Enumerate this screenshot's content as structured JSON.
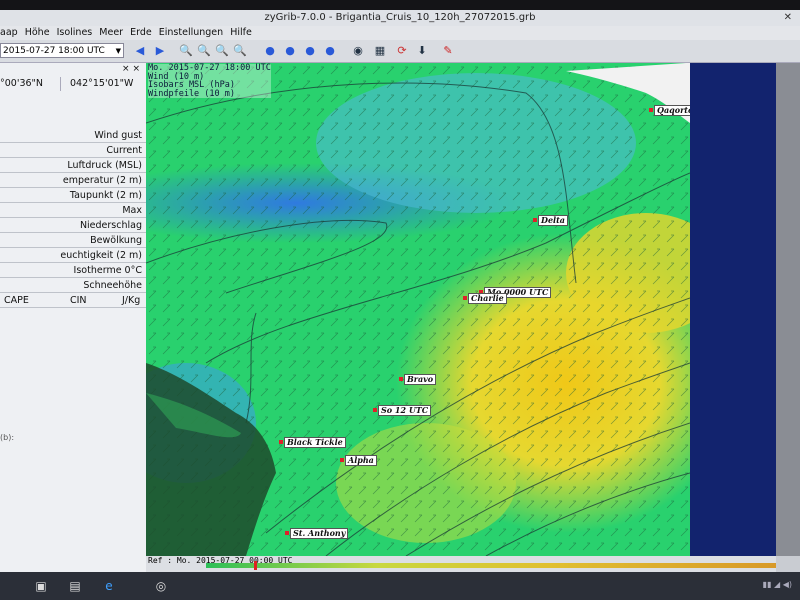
{
  "window": {
    "title": "zyGrib-7.0.0 - Brigantia_Cruis_10_120h_27072015.grb",
    "close": "✕"
  },
  "menu": [
    "aap",
    "Höhe",
    "Isolines",
    "Meer",
    "Erde",
    "Einstellungen",
    "Hilfe"
  ],
  "toolbar": {
    "date": "2015-07-27 18:00 UTC"
  },
  "sidebar": {
    "lat": "°00'36\"N",
    "lon": "042°15'01\"W",
    "close": "× ×",
    "rows": [
      "Wind gust",
      "Current",
      "Luftdruck (MSL)",
      "emperatur (2 m)",
      "Taupunkt (2 m)",
      "Max",
      "Niederschlag",
      "Bewölkung",
      "euchtigkeit (2 m)",
      "Isotherme 0°C",
      "Schneehöhe"
    ],
    "last_row": {
      "a": "CAPE",
      "b": "CIN",
      "c": "J/Kg"
    },
    "footer": "(b):"
  },
  "map": {
    "overlay_lines": [
      "Mo. 2015-07-27 18:00 UTC",
      "Wind (10 m)",
      "Isobars MSL (hPa)",
      "Windpfeile (10 m)"
    ],
    "stations": {
      "qaqortoq": "Qaqortoq",
      "delta": "Delta",
      "charlie": "Charlie",
      "mo_utc": "Mo 0000 UTC",
      "bravo": "Bravo",
      "so_utc": "So 12 UTC",
      "black_tickle": "Black Tickle",
      "alpha": "Alpha",
      "st_anthony": "St. Anthony"
    }
  },
  "timeline": {
    "label": "Ref : Mo. 2015-07-27 00:00 UTC"
  },
  "colors": {
    "map_green": "#29d16e",
    "map_yellow": "#e6d830",
    "map_blue": "#3a9ae6",
    "ocean_dark": "#12236e",
    "land": "#f2f2f2"
  }
}
